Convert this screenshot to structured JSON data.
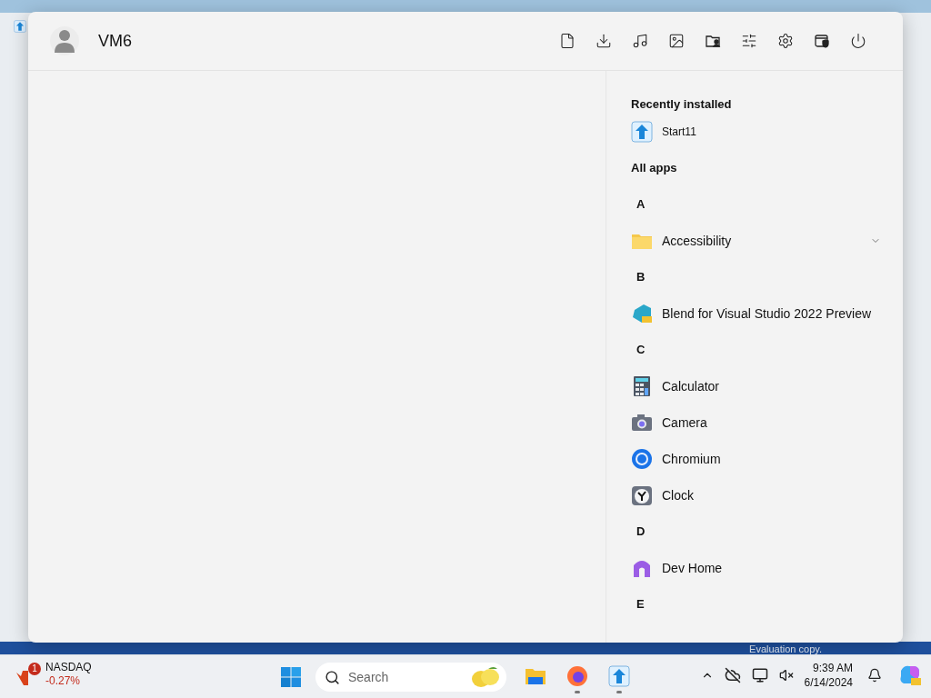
{
  "start_menu": {
    "user": {
      "name": "VM6"
    },
    "recently_installed": {
      "title": "Recently installed",
      "items": [
        {
          "name": "Start11"
        }
      ]
    },
    "all_apps": {
      "title": "All apps",
      "groups": [
        {
          "letter": "A",
          "apps": [
            {
              "name": "Accessibility",
              "kind": "folder",
              "expanded": false
            }
          ]
        },
        {
          "letter": "B",
          "apps": [
            {
              "name": "Blend for Visual Studio 2022 Preview",
              "kind": "app"
            }
          ]
        },
        {
          "letter": "C",
          "apps": [
            {
              "name": "Calculator",
              "kind": "app"
            },
            {
              "name": "Camera",
              "kind": "app"
            },
            {
              "name": "Chromium",
              "kind": "app"
            },
            {
              "name": "Clock",
              "kind": "app"
            }
          ]
        },
        {
          "letter": "D",
          "apps": [
            {
              "name": "Dev Home",
              "kind": "app"
            }
          ]
        },
        {
          "letter": "E"
        }
      ]
    }
  },
  "desktop": {
    "watermark": "Evaluation copy."
  },
  "taskbar": {
    "widget": {
      "title": "NASDAQ",
      "change": "-0.27%",
      "badge": "1"
    },
    "search": {
      "placeholder": "Search"
    },
    "apps": [
      {
        "running": false
      },
      {
        "running": true
      },
      {
        "running": true
      }
    ],
    "clock": {
      "time": "9:39 AM",
      "date": "6/14/2024"
    }
  }
}
